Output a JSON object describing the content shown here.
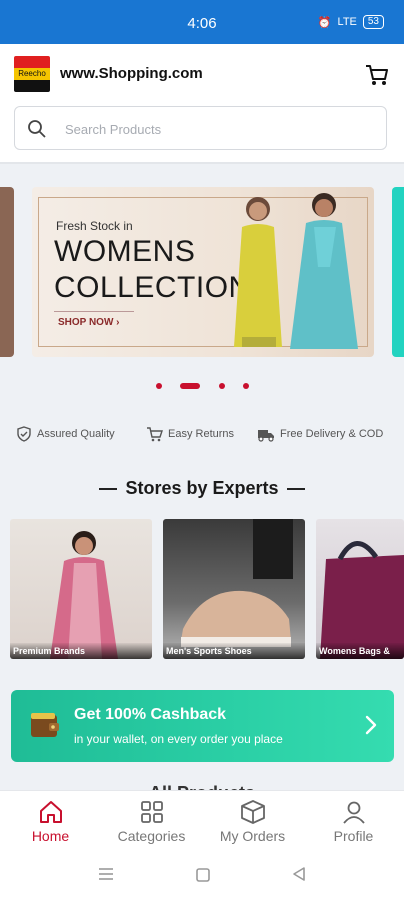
{
  "status": {
    "time": "4:06",
    "signal": "LTE",
    "battery": "53"
  },
  "header": {
    "logo_text": "Reecho",
    "site_title": "www.Shopping.com"
  },
  "search": {
    "placeholder": "Search Products"
  },
  "banner": {
    "subtitle": "Fresh Stock in",
    "line1": "WOMENS",
    "line2": "COLLECTION",
    "cta": "SHOP NOW ›"
  },
  "carousel": {
    "slide_count": 4,
    "active_index": 1
  },
  "features": [
    {
      "label": "Assured Quality",
      "icon": "shield-check-icon"
    },
    {
      "label": "Easy Returns",
      "icon": "cart-return-icon"
    },
    {
      "label": "Free Delivery & COD",
      "icon": "truck-icon"
    }
  ],
  "stores": {
    "title": "Stores by Experts",
    "items": [
      {
        "label": "Premium Brands"
      },
      {
        "label": "Men's Sports Shoes"
      },
      {
        "label": "Womens Bags &"
      }
    ]
  },
  "cashback": {
    "title": "Get 100% Cashback",
    "subtitle": "in your wallet, on every order you place"
  },
  "all_products": {
    "title": "All Products"
  },
  "bottom_nav": [
    {
      "label": "Home",
      "icon": "home-icon",
      "active": true
    },
    {
      "label": "Categories",
      "icon": "grid-icon",
      "active": false
    },
    {
      "label": "My Orders",
      "icon": "box-icon",
      "active": false
    },
    {
      "label": "Profile",
      "icon": "person-icon",
      "active": false
    }
  ],
  "colors": {
    "accent": "#c8102e",
    "status_bar": "#1976d2",
    "cashback": "#2bd0a6"
  }
}
